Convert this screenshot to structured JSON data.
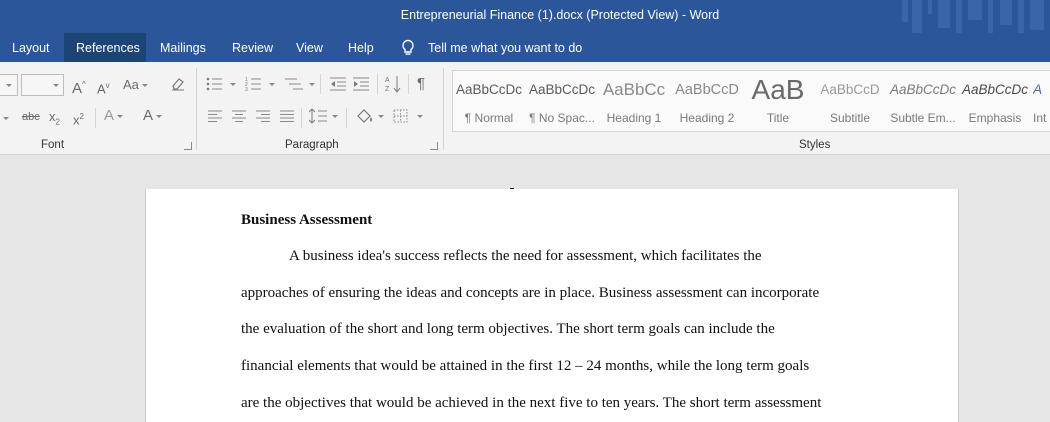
{
  "window": {
    "title": "Entrepreneurial Finance (1).docx (Protected View)  -  Word"
  },
  "menu": {
    "tabs": [
      {
        "label": "Layout"
      },
      {
        "label": "References"
      },
      {
        "label": "Mailings"
      },
      {
        "label": "Review"
      },
      {
        "label": "View"
      },
      {
        "label": "Help"
      }
    ],
    "active_tab": "References",
    "tell_me": "Tell me what you want to do"
  },
  "ribbon": {
    "font_group": {
      "label": "Font",
      "buttons": {
        "grow": "A",
        "shrink": "A",
        "change_case": "Aa",
        "strikethrough": "abc",
        "subscript": "x",
        "subscript_suffix": "2",
        "superscript": "x",
        "superscript_suffix": "2",
        "text_effects": "A",
        "font_color": "A"
      }
    },
    "paragraph_group": {
      "label": "Paragraph",
      "pilcrow": "¶"
    },
    "styles_group": {
      "label": "Styles",
      "styles": [
        {
          "sample": "AaBbCcDc",
          "name": "¶ Normal"
        },
        {
          "sample": "AaBbCcDc",
          "name": "¶ No Spac..."
        },
        {
          "sample": "AaBbCc",
          "name": "Heading 1"
        },
        {
          "sample": "AaBbCcD",
          "name": "Heading 2"
        },
        {
          "sample": "AaB",
          "name": "Title"
        },
        {
          "sample": "AaBbCcD",
          "name": "Subtitle"
        },
        {
          "sample": "AaBbCcDc",
          "name": "Subtle Em..."
        },
        {
          "sample": "AaBbCcDc",
          "name": "Emphasis"
        },
        {
          "sample": "A",
          "name": "Int"
        }
      ]
    }
  },
  "colors": {
    "word_blue": "#2b579a",
    "active_tab": "#1d4477",
    "ribbon_bg": "#f3f3f3",
    "canvas_bg": "#e6e6e6"
  },
  "document": {
    "heading": "Business Assessment",
    "lines": [
      "A business idea's success reflects the need for assessment, which facilitates the",
      "approaches of ensuring the ideas and concepts are in place. Business assessment can incorporate",
      "the evaluation of the short and long term objectives. The short term goals can include the",
      "financial elements that would be attained in the first 12 – 24 months, while the long term goals",
      "are the objectives that would be achieved in the next five to ten years. The short term assessment"
    ]
  }
}
